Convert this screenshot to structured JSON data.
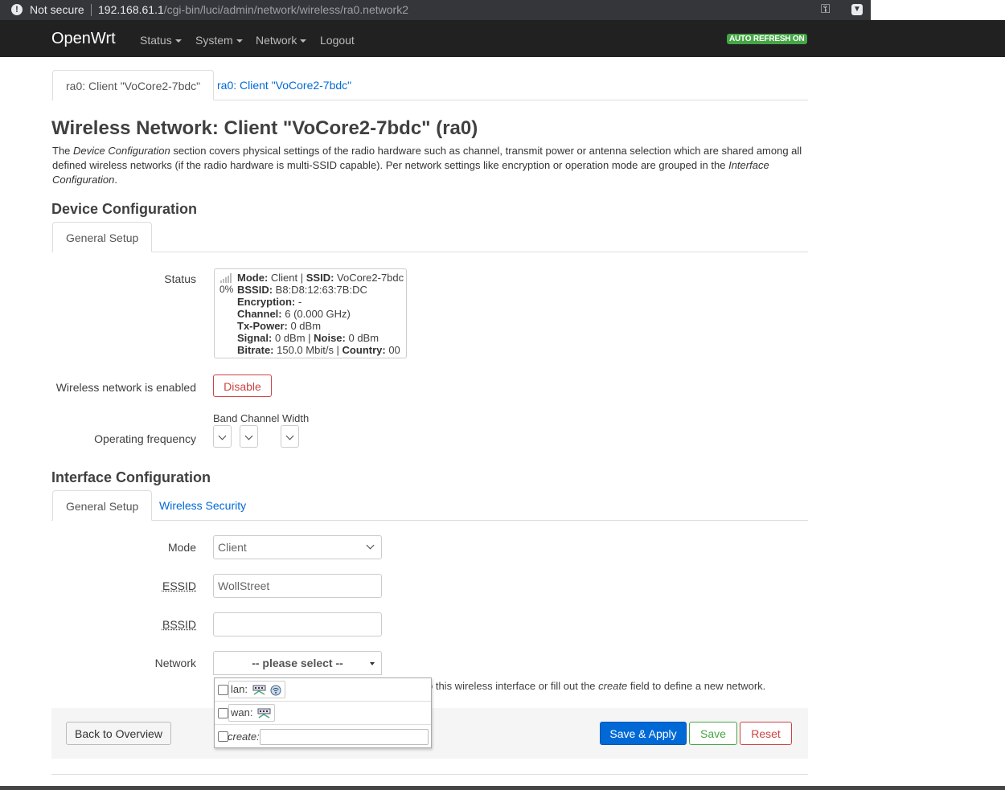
{
  "browser": {
    "security_label": "Not secure",
    "url_host": "192.168.61.1",
    "url_path": "/cgi-bin/luci/admin/network/wireless/ra0.network2",
    "key_icon": "key-icon",
    "ext_icon": "extension-icon"
  },
  "header": {
    "brand": "OpenWrt",
    "menu": [
      "Status",
      "System",
      "Network",
      "Logout"
    ],
    "auto_refresh": "AUTO REFRESH ON"
  },
  "top_tabs": [
    "ra0: Client \"VoCore2-7bdc\"",
    "ra0: Client \"VoCore2-7bdc\""
  ],
  "page": {
    "title": "Wireless Network: Client \"VoCore2-7bdc\" (ra0)",
    "desc_1": "The ",
    "desc_2": "Device Configuration",
    "desc_3": " section covers physical settings of the radio hardware such as channel, transmit power or antenna selection which are shared among all defined wireless networks (if the radio hardware is multi-SSID capable). Per network settings like encryption or operation mode are grouped in the ",
    "desc_4": "Interface Configuration",
    "desc_5": "."
  },
  "device": {
    "heading": "Device Configuration",
    "tab": "General Setup",
    "status_label": "Status",
    "signal_percent": "0%",
    "status": {
      "mode_k": "Mode:",
      "mode_v": " Client | ",
      "ssid_k": "SSID:",
      "ssid_v": " VoCore2-7bdc",
      "bssid_k": "BSSID:",
      "bssid_v": " B8:D8:12:63:7B:DC",
      "enc_k": "Encryption:",
      "enc_v": " -",
      "chan_k": "Channel:",
      "chan_v": " 6 (0.000 GHz)",
      "tx_k": "Tx-Power:",
      "tx_v": " 0 dBm",
      "sig_k": "Signal:",
      "sig_v": " 0 dBm | ",
      "noise_k": "Noise:",
      "noise_v": " 0 dBm",
      "bitrate_k": "Bitrate:",
      "bitrate_v": " 150.0 Mbit/s | ",
      "country_k": "Country:",
      "country_v": " 00"
    },
    "enabled_label": "Wireless network is enabled",
    "disable_btn": "Disable",
    "freq_label": "Operating frequency",
    "freq_head": "Band Channel Width"
  },
  "iface": {
    "heading": "Interface Configuration",
    "tabs": [
      "General Setup",
      "Wireless Security"
    ],
    "mode_label": "Mode",
    "mode_value": "Client",
    "essid_label": "ESSID",
    "essid_value": "WollStreet",
    "bssid_label": "BSSID",
    "bssid_value": "",
    "network_label": "Network",
    "network_placeholder": "-- please select --",
    "help_1": "o this wireless interface or fill out the ",
    "help_2": "create",
    "help_3": " field to define a new network.",
    "options": [
      {
        "name": "lan:"
      },
      {
        "name": "wan:"
      },
      {
        "name": "create:"
      }
    ]
  },
  "actions": {
    "back": "Back to Overview",
    "save_apply": "Save & Apply",
    "save": "Save",
    "reset": "Reset"
  }
}
